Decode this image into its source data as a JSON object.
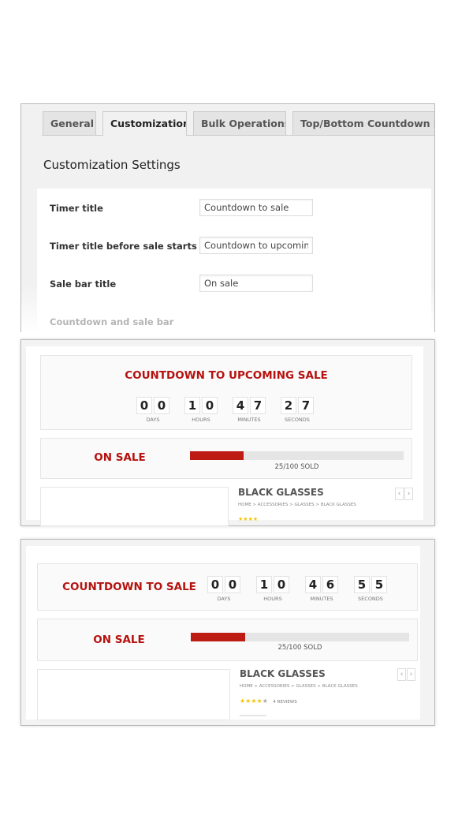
{
  "settings": {
    "tabs": [
      {
        "label": "General"
      },
      {
        "label": "Customization",
        "active": true
      },
      {
        "label": "Bulk Operations"
      },
      {
        "label": "Top/Bottom Countdown bar"
      }
    ],
    "heading": "Customization Settings",
    "fields": [
      {
        "label": "Timer title",
        "value": "Countdown to sale"
      },
      {
        "label": "Timer title before sale starts",
        "value": "Countdown to upcoming"
      },
      {
        "label": "Sale bar title",
        "value": "On sale"
      }
    ],
    "faded_label": "Countdown and sale bar"
  },
  "colors": {
    "accent": "#b5120f",
    "bar_fill": "#bd1c12",
    "bar_track": "#e5e5e5",
    "stars": "#f5c400"
  },
  "preview_upcoming": {
    "title": "COUNTDOWN TO UPCOMING SALE",
    "units": [
      {
        "digits": [
          "0",
          "0"
        ],
        "label": "DAYS"
      },
      {
        "digits": [
          "1",
          "0"
        ],
        "label": "HOURS"
      },
      {
        "digits": [
          "4",
          "7"
        ],
        "label": "MINUTES"
      },
      {
        "digits": [
          "2",
          "7"
        ],
        "label": "SECONDS"
      }
    ],
    "sale_title": "ON SALE",
    "sold_percent": 25,
    "sold_text": "25/100 SOLD",
    "product": {
      "title": "BLACK GLASSES",
      "breadcrumb": "HOME > ACCESSORIES > GLASSES > BLACK GLASSES",
      "prev": "‹",
      "next": "›"
    }
  },
  "preview_sale": {
    "title": "COUNTDOWN TO SALE",
    "units": [
      {
        "digits": [
          "0",
          "0"
        ],
        "label": "DAYS"
      },
      {
        "digits": [
          "1",
          "0"
        ],
        "label": "HOURS"
      },
      {
        "digits": [
          "4",
          "6"
        ],
        "label": "MINUTES"
      },
      {
        "digits": [
          "5",
          "5"
        ],
        "label": "SECONDS"
      }
    ],
    "sale_title": "ON SALE",
    "sold_percent": 25,
    "sold_text": "25/100 SOLD",
    "product": {
      "title": "BLACK GLASSES",
      "breadcrumb": "HOME > ACCESSORIES > GLASSES > BLACK GLASSES",
      "rating": 4,
      "rating_max": 5,
      "reviews": "4 REVIEWS",
      "prev": "‹",
      "next": "›"
    }
  }
}
